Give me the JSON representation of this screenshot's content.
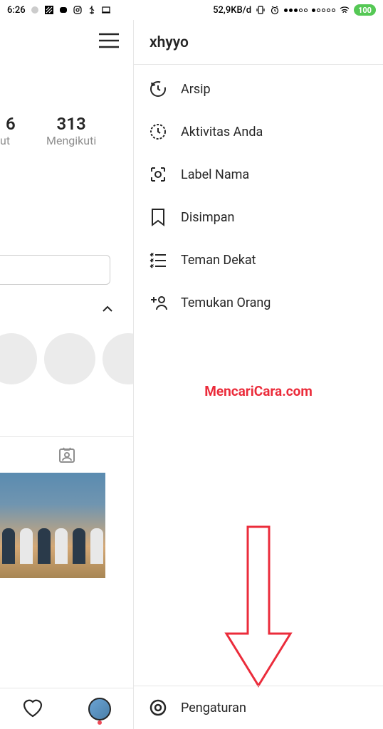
{
  "status_bar": {
    "time": "6:26",
    "net_speed": "52,9KB/d",
    "battery": "100"
  },
  "profile": {
    "stat1_num": "6",
    "stat1_label": "ut",
    "stat2_num": "313",
    "stat2_label": "Mengikuti"
  },
  "drawer": {
    "username": "xhyyo",
    "items": [
      {
        "icon": "archive-icon",
        "label": "Arsip"
      },
      {
        "icon": "activity-icon",
        "label": "Aktivitas Anda"
      },
      {
        "icon": "nametag-icon",
        "label": "Label Nama"
      },
      {
        "icon": "saved-icon",
        "label": "Disimpan"
      },
      {
        "icon": "close-friends-icon",
        "label": "Teman Dekat"
      },
      {
        "icon": "discover-people-icon",
        "label": "Temukan Orang"
      }
    ],
    "settings_label": "Pengaturan"
  },
  "watermark": "MencariCara.com"
}
